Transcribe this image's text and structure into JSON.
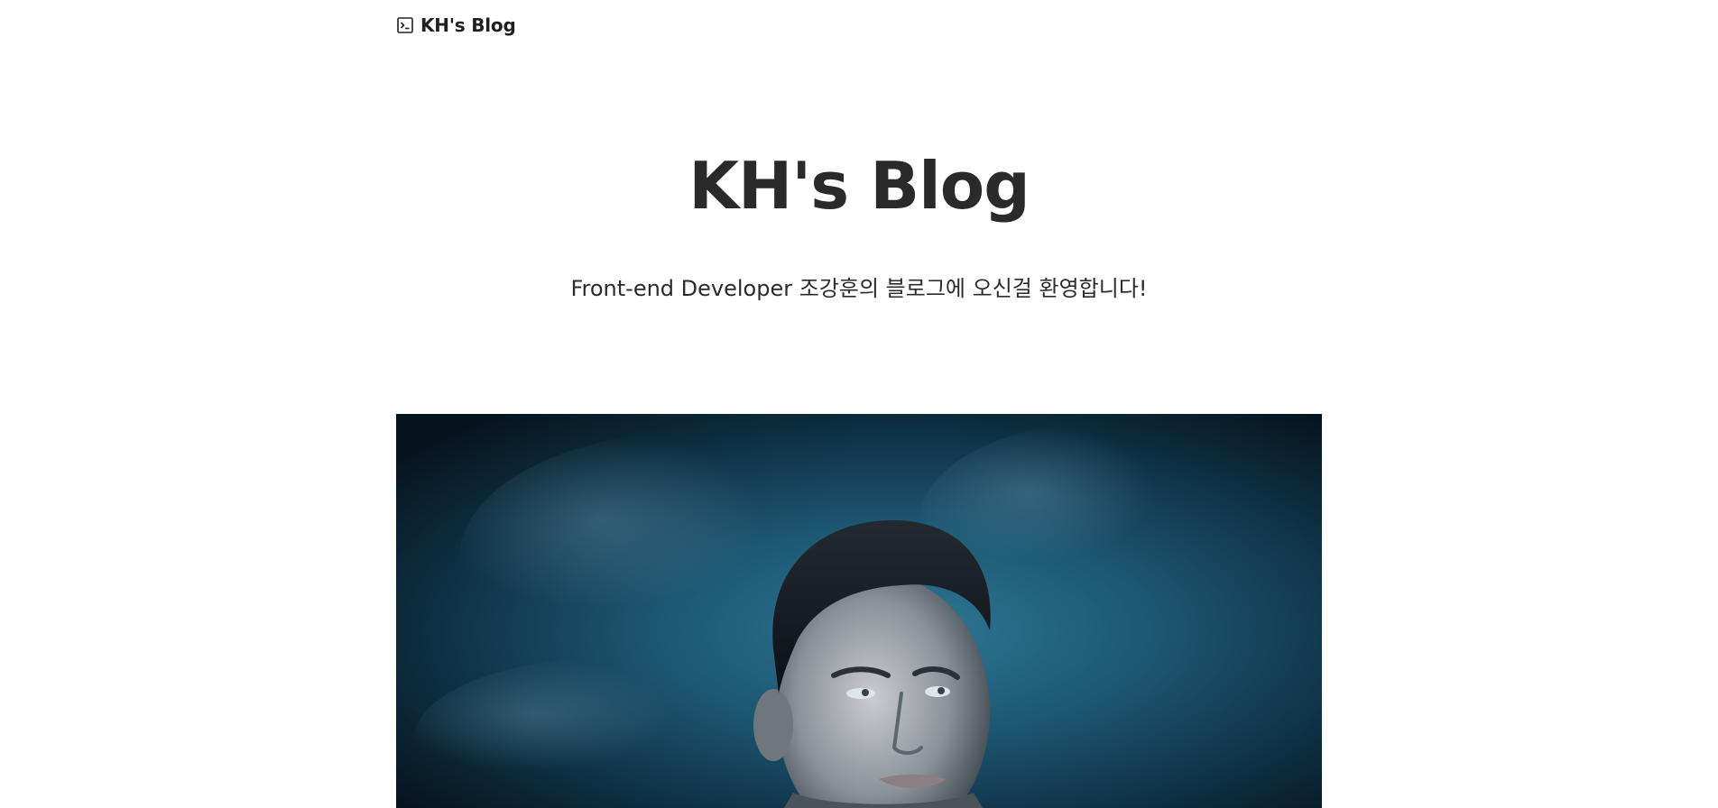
{
  "header": {
    "brand_label": "KH's Blog",
    "brand_icon": "terminal-icon"
  },
  "hero": {
    "title": "KH's Blog",
    "subtitle": "Front-end Developer 조강훈의 블로그에 오신걸 환영합니다!"
  },
  "featured_image": {
    "description_icon": "portrait-photo"
  },
  "colors": {
    "background": "#ffffff",
    "text": "#222222",
    "image_dark": "#0b2232",
    "image_teal": "#1f5d78"
  }
}
